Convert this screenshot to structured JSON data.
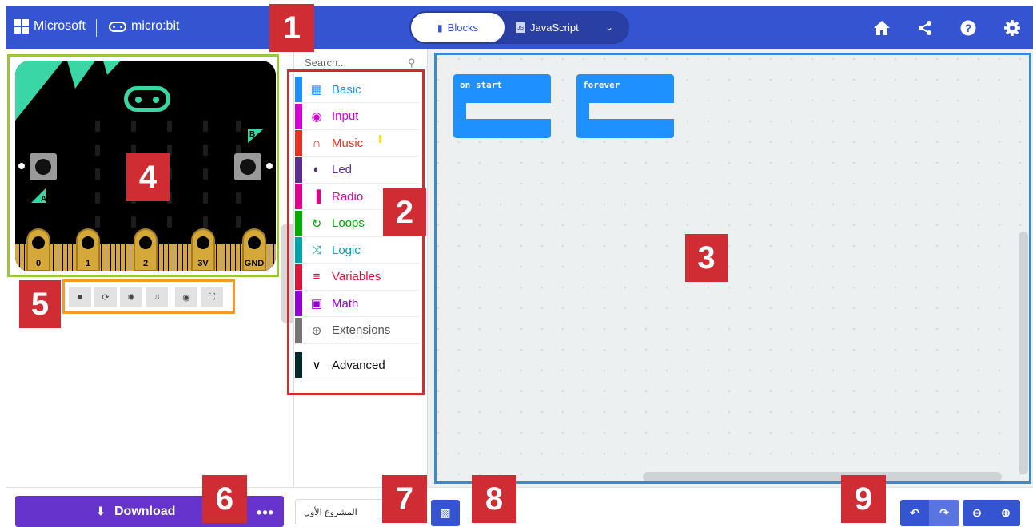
{
  "header": {
    "brand_microsoft": "Microsoft",
    "brand_microbit": "micro:bit",
    "tab_blocks": "Blocks",
    "tab_javascript": "JavaScript",
    "icons": [
      "home-icon",
      "share-icon",
      "help-icon",
      "settings-icon"
    ],
    "color": "#3454d1"
  },
  "simulator": {
    "button_a": "A",
    "button_b": "B",
    "pins": [
      "0",
      "1",
      "2",
      "3V",
      "GND"
    ],
    "toolbar_icons": [
      "stop-icon",
      "restart-icon",
      "debug-icon",
      "mute-icon",
      "screenshot-icon",
      "fullscreen-icon"
    ]
  },
  "toolbox": {
    "search_placeholder": "Search...",
    "categories": [
      {
        "label": "Basic",
        "color": "#1e90ff",
        "icon": "grid-icon"
      },
      {
        "label": "Input",
        "color": "#d400d4",
        "icon": "target-icon"
      },
      {
        "label": "Music",
        "color": "#e63022",
        "icon": "headphones-icon"
      },
      {
        "label": "Led",
        "color": "#5c2d91",
        "icon": "toggle-icon"
      },
      {
        "label": "Radio",
        "color": "#e3008c",
        "icon": "signal-icon"
      },
      {
        "label": "Loops",
        "color": "#00aa00",
        "icon": "loop-icon"
      },
      {
        "label": "Logic",
        "color": "#00a4a6",
        "icon": "shuffle-icon"
      },
      {
        "label": "Variables",
        "color": "#dc143c",
        "icon": "list-icon"
      },
      {
        "label": "Math",
        "color": "#9400d3",
        "icon": "calculator-icon"
      },
      {
        "label": "Extensions",
        "color": "#777777",
        "icon": "plus-icon"
      },
      {
        "label": "Advanced",
        "color": "#002a2a",
        "icon": "chevron-down-icon"
      }
    ]
  },
  "workspace": {
    "blocks": [
      {
        "label": "on start"
      },
      {
        "label": "forever"
      }
    ]
  },
  "bottom": {
    "download_label": "Download",
    "more_label": "•••",
    "project_name": "المشروع الأول"
  },
  "badges": [
    "1",
    "2",
    "3",
    "4",
    "5",
    "6",
    "7",
    "8",
    "9"
  ]
}
